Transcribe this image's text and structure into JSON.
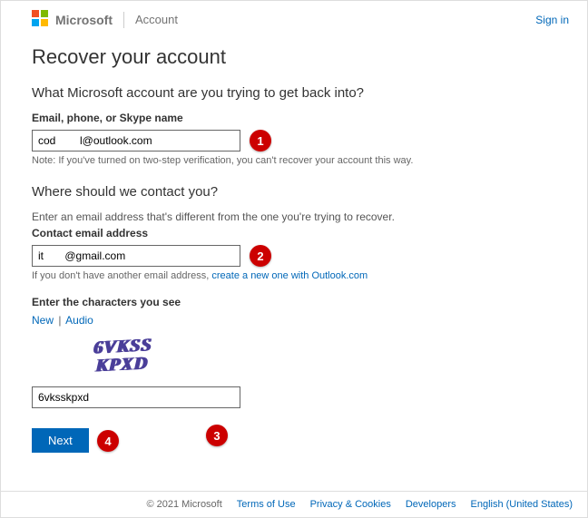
{
  "header": {
    "brand": "Microsoft",
    "section": "Account",
    "signin": "Sign in"
  },
  "page": {
    "title": "Recover your account",
    "q1": "What Microsoft account are you trying to get back into?",
    "email_label": "Email, phone, or Skype name",
    "email_value": "cod        l@outlook.com",
    "email_note": "Note: If you've turned on two-step verification, you can't recover your account this way.",
    "q2": "Where should we contact you?",
    "contact_intro": "Enter an email address that's different from the one you're trying to recover.",
    "contact_label": "Contact email address",
    "contact_value": "it       @gmail.com",
    "contact_note_prefix": "If you don't have another email address, ",
    "contact_note_link": "create a new one with Outlook.com",
    "captcha_label": "Enter the characters you see",
    "captcha_new": "New",
    "captcha_audio": "Audio",
    "captcha_image_text": "6VKSS\nKPXD",
    "captcha_value": "6vksskpxd",
    "next": "Next"
  },
  "markers": {
    "m1": "1",
    "m2": "2",
    "m3": "3",
    "m4": "4"
  },
  "footer": {
    "copyright": "© 2021 Microsoft",
    "terms": "Terms of Use",
    "privacy": "Privacy & Cookies",
    "developers": "Developers",
    "lang": "English (United States)"
  }
}
